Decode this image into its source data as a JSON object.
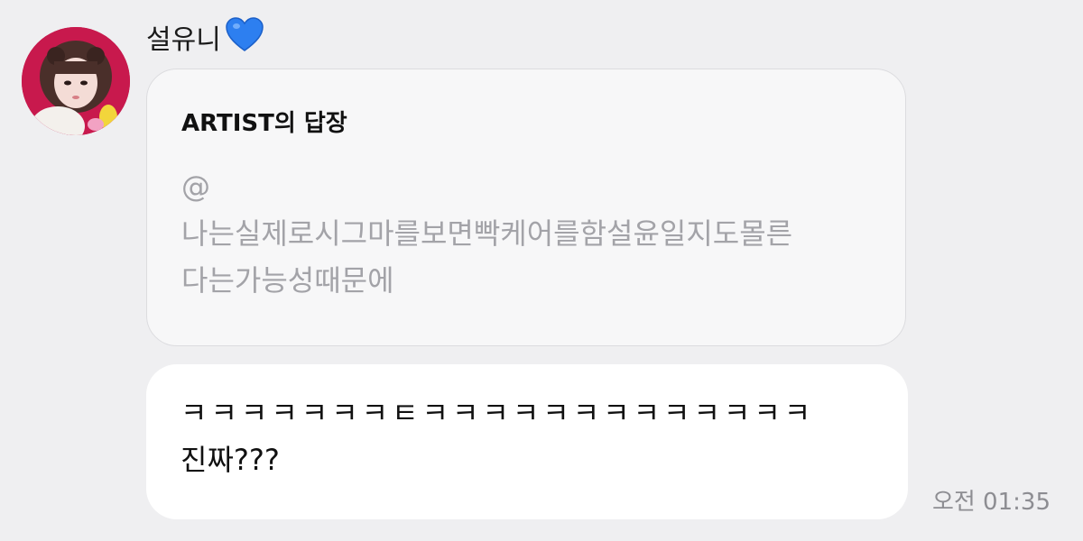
{
  "sender": {
    "name": "설유니",
    "heart_icon": "blue-heart-icon",
    "heart_color": "#2d7ff0"
  },
  "reply": {
    "title": "ARTIST의 답장",
    "quote_lines": [
      "@",
      "나는실제로시그마를보면빡케어를함설윤일지도몰른",
      "다는가능성때문에"
    ]
  },
  "message": {
    "lines": [
      "ㅋㅋㅋㅋㅋㅋㅋㅌㅋㅋㅋㅋㅋㅋㅋㅋㅋㅋㅋㅋㅋ",
      "진짜???"
    ]
  },
  "timestamp": "오전 01:35",
  "colors": {
    "background": "#efeff1",
    "reply_bubble": "#f7f7f8",
    "message_bubble": "#ffffff",
    "quote_text": "#a3a3a8",
    "timestamp_text": "#8d8d92"
  }
}
